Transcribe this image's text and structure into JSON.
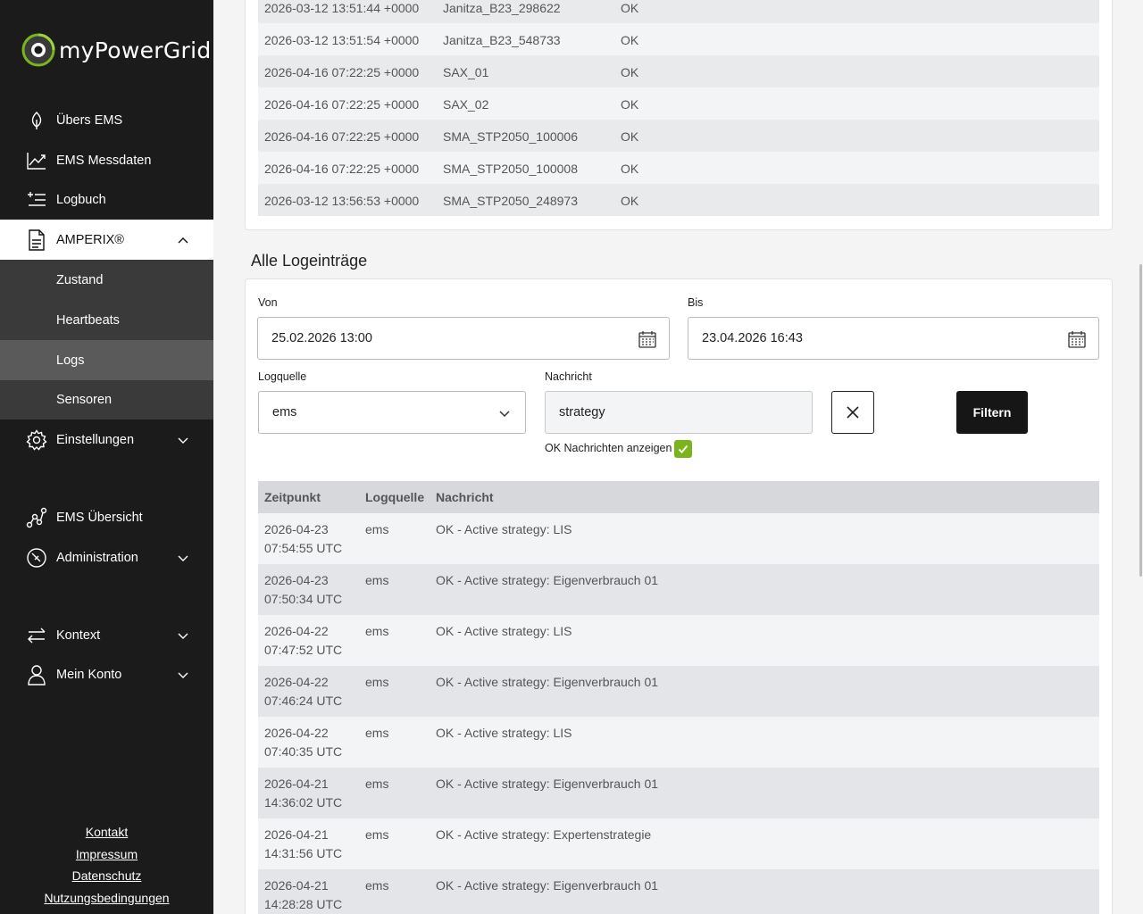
{
  "brand": {
    "name": "myPowerGrid"
  },
  "sidebar": {
    "items": [
      {
        "label": "Übers EMS",
        "icon": "leaf-icon"
      },
      {
        "label": "EMS Messdaten",
        "icon": "chart-line-icon"
      },
      {
        "label": "Logbuch",
        "icon": "list-add-icon"
      },
      {
        "label": "AMPERIX®",
        "icon": "document-icon"
      },
      {
        "label": "Einstellungen",
        "icon": "gear-icon"
      },
      {
        "label": "EMS Übersicht",
        "icon": "graph-nodes-icon"
      },
      {
        "label": "Administration",
        "icon": "compass-icon"
      },
      {
        "label": "Kontext",
        "icon": "swap-arrows-icon"
      },
      {
        "label": "Mein Konto",
        "icon": "user-icon"
      }
    ],
    "subitems": [
      "Zustand",
      "Heartbeats",
      "Logs",
      "Sensoren"
    ],
    "footer": [
      "Kontakt",
      "Impressum",
      "Datenschutz",
      "Nutzungsbedingungen"
    ]
  },
  "heartbeats": [
    {
      "time": "2026-03-12 13:51:44 +0000",
      "device": "Janitza_B23_298622",
      "status": "OK"
    },
    {
      "time": "2026-03-12 13:51:54 +0000",
      "device": "Janitza_B23_548733",
      "status": "OK"
    },
    {
      "time": "2026-04-16 07:22:25 +0000",
      "device": "SAX_01",
      "status": "OK"
    },
    {
      "time": "2026-04-16 07:22:25 +0000",
      "device": "SAX_02",
      "status": "OK"
    },
    {
      "time": "2026-04-16 07:22:25 +0000",
      "device": "SMA_STP2050_100006",
      "status": "OK"
    },
    {
      "time": "2026-04-16 07:22:25 +0000",
      "device": "SMA_STP2050_100008",
      "status": "OK"
    },
    {
      "time": "2026-03-12 13:56:53 +0000",
      "device": "SMA_STP2050_248973",
      "status": "OK"
    }
  ],
  "logs": {
    "title": "Alle Logeinträge",
    "from_label": "Von",
    "from_value": "25.02.2026 13:00",
    "to_label": "Bis",
    "to_value": "23.04.2026 16:43",
    "source_label": "Logquelle",
    "source_value": "ems",
    "message_label": "Nachricht",
    "message_value": "strategy",
    "filter_label": "Filtern",
    "ok_label": "OK Nachrichten anzeigen",
    "ok_checked": true,
    "columns": [
      "Zeitpunkt",
      "Logquelle",
      "Nachricht"
    ],
    "rows": [
      {
        "date": "2026-04-23",
        "time": "07:54:55 UTC",
        "source": "ems",
        "message": "OK - Active strategy: LIS"
      },
      {
        "date": "2026-04-23",
        "time": "07:50:34 UTC",
        "source": "ems",
        "message": "OK - Active strategy: Eigenverbrauch 01"
      },
      {
        "date": "2026-04-22",
        "time": "07:47:52 UTC",
        "source": "ems",
        "message": "OK - Active strategy: LIS"
      },
      {
        "date": "2026-04-22",
        "time": "07:46:24 UTC",
        "source": "ems",
        "message": "OK - Active strategy: Eigenverbrauch 01"
      },
      {
        "date": "2026-04-22",
        "time": "07:40:35 UTC",
        "source": "ems",
        "message": "OK - Active strategy: LIS"
      },
      {
        "date": "2026-04-21",
        "time": "14:36:02 UTC",
        "source": "ems",
        "message": "OK - Active strategy: Eigenverbrauch 01"
      },
      {
        "date": "2026-04-21",
        "time": "14:31:56 UTC",
        "source": "ems",
        "message": "OK - Active strategy: Expertenstrategie"
      },
      {
        "date": "2026-04-21",
        "time": "14:28:28 UTC",
        "source": "ems",
        "message": "OK - Active strategy: Eigenverbrauch 01"
      }
    ]
  }
}
